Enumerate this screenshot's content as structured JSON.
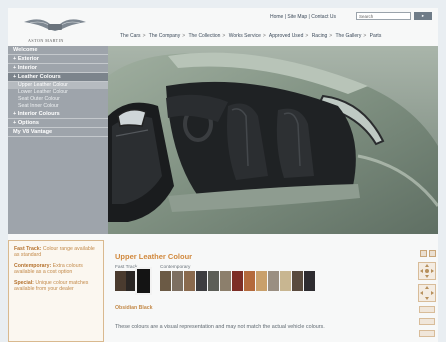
{
  "header": {
    "brand": "ASTON MARTIN",
    "top_links": [
      "Home",
      "Site Map",
      "Contact Us"
    ],
    "search_placeholder": "Search",
    "nav": [
      "The Cars",
      "The Company",
      "The Collection",
      "Works Service",
      "Approved Used",
      "Racing",
      "The Gallery",
      "Parts"
    ]
  },
  "sidebar": {
    "items": [
      {
        "label": "Welcome",
        "active": false
      },
      {
        "label": "+ Exterior",
        "active": false
      },
      {
        "label": "+ Interior",
        "active": false
      },
      {
        "label": "+ Leather Colours",
        "active": true
      }
    ],
    "subitems": [
      "Upper Leather Colour",
      "Lower Leather Colour",
      "Seat Outer Colour",
      "Seat Inner Colour"
    ],
    "after": [
      "+ Interior Colours",
      "+ Options",
      "My V8 Vantage"
    ]
  },
  "info": {
    "p1_title": "Fast Track:",
    "p1_text": " Colour range available as standard",
    "p2_title": "Contemporary:",
    "p2_text": " Extra colours available as a cost option",
    "p3_title": "Special:",
    "p3_text": " Unique colour matches available from your dealer"
  },
  "colour": {
    "title": "Upper Leather Colour",
    "fast_track_label": "Fast Track",
    "contemporary_label": "Contemporary",
    "selected_name": "Obsidian Black",
    "note": "These colours are a visual representation and may not match the actual vehicle colours."
  },
  "fast_track_swatches": [
    "#4a3b2f",
    "#2a2624",
    "#141414"
  ],
  "contemporary_swatches": [
    "#6b5a45",
    "#7d6f61",
    "#8a6a4e",
    "#3d3d40",
    "#5c5e57",
    "#8c7f6c",
    "#7d2e26",
    "#b46a3c",
    "#c9a06b",
    "#9a8f82",
    "#c8b691",
    "#5a4b3e",
    "#2e2c30"
  ],
  "colors": {
    "accent": "#d1893e",
    "sidebar": "#9ea4ab",
    "body_paint": "#8a9a8c"
  }
}
